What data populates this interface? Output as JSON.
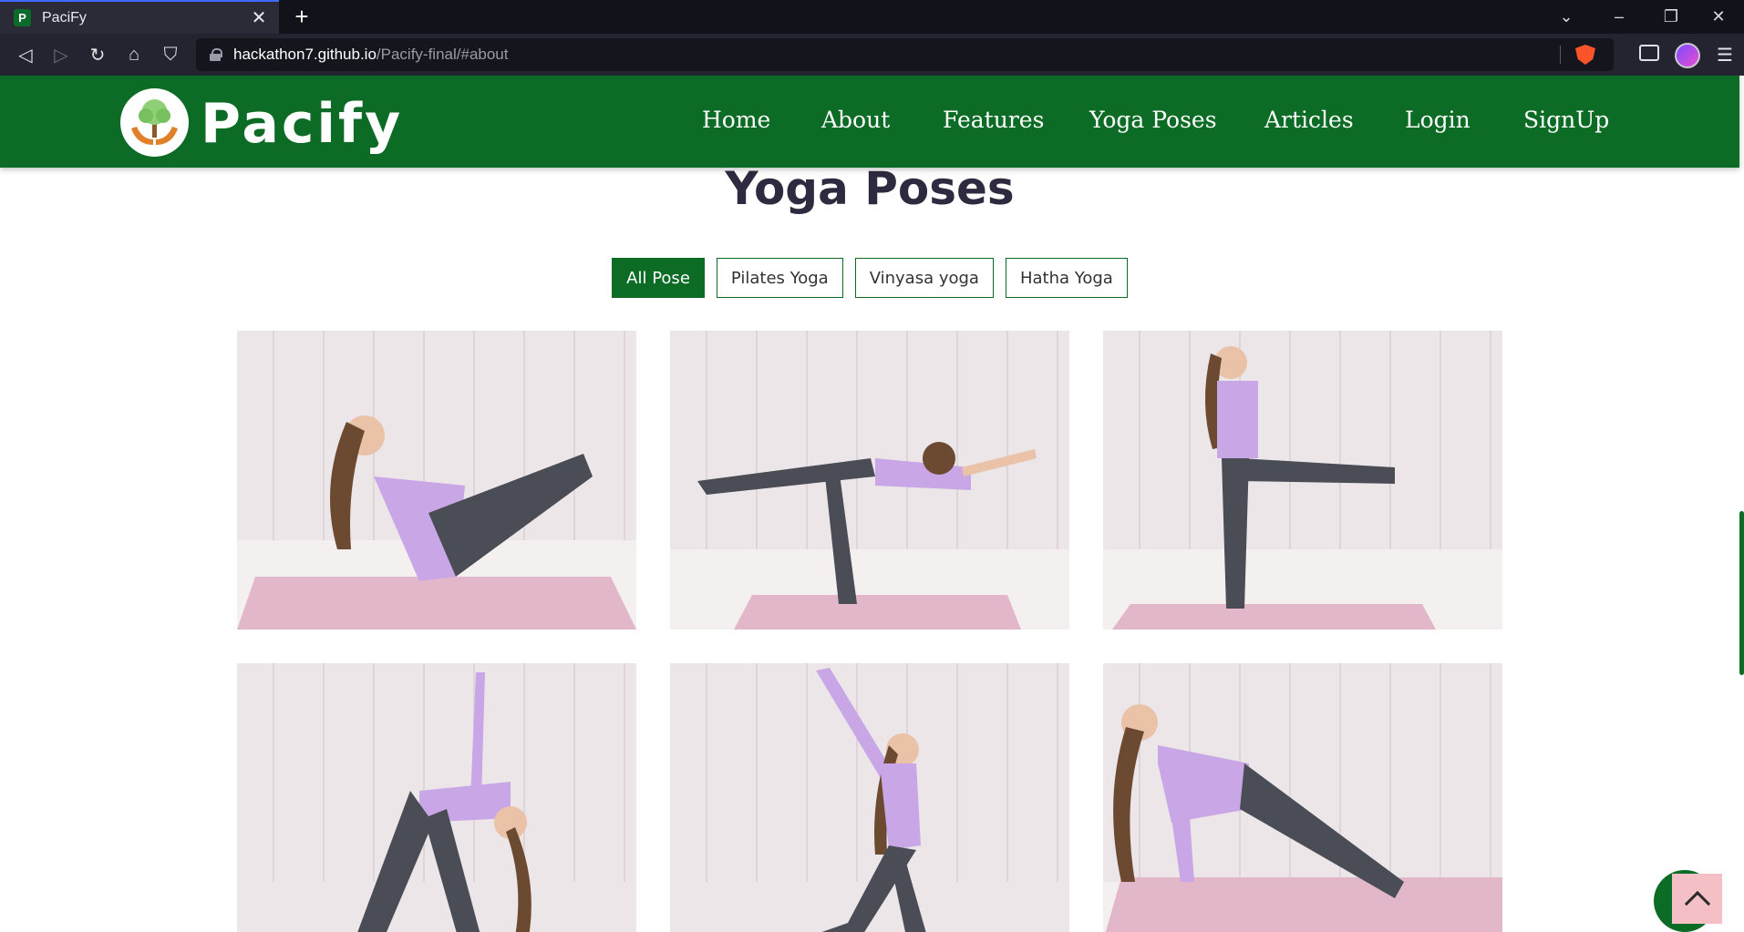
{
  "browser": {
    "tab_title": "PaciFy",
    "tab_favicon_letter": "P",
    "url_host": "hackathon7.github.io",
    "url_path": "/Pacify-final/#about"
  },
  "site": {
    "brand": "Pacify",
    "nav": [
      "Home",
      "About",
      "Features",
      "Yoga Poses",
      "Articles",
      "Login",
      "SignUp"
    ],
    "section_title": "Yoga Poses",
    "filters": [
      {
        "label": "All Pose",
        "active": true
      },
      {
        "label": "Pilates Yoga",
        "active": false
      },
      {
        "label": "Vinyasa yoga",
        "active": false
      },
      {
        "label": "Hatha Yoga",
        "active": false
      }
    ]
  },
  "colors": {
    "header_green": "#0c6b24",
    "title_text": "#2f2a3f",
    "back_to_top_bg": "#f4c0c6"
  },
  "icons": {
    "back": "back-icon",
    "forward": "forward-icon",
    "reload": "reload-icon",
    "home": "home-icon",
    "bookmark": "bookmark-icon",
    "lock": "lock-icon",
    "shield": "brave-shield-icon",
    "wallet": "wallet-icon",
    "menu": "hamburger-menu-icon",
    "back_to_top": "chevron-up-icon"
  }
}
